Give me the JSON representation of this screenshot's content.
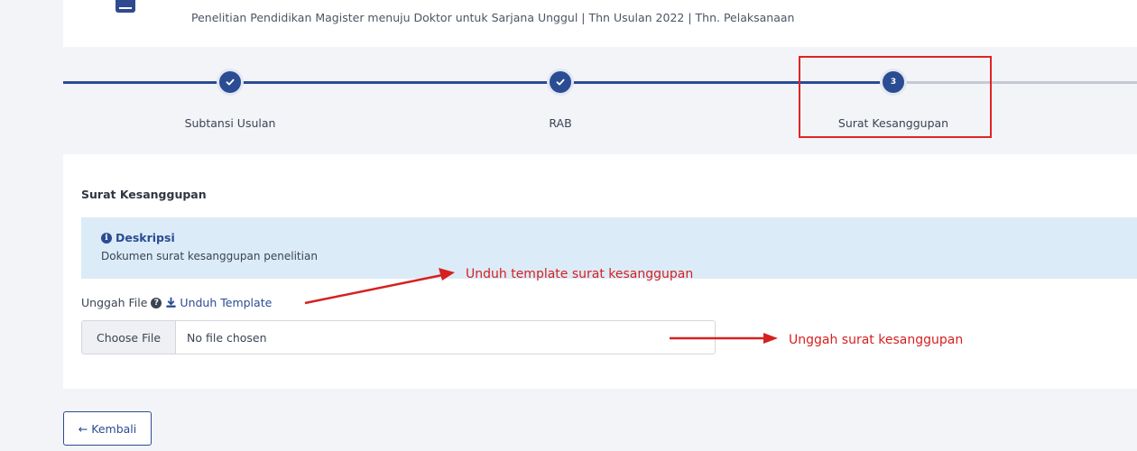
{
  "header": {
    "subtitle": "Penelitian Pendidikan Magister menuju Doktor untuk Sarjana Unggul | Thn Usulan 2022 | Thn. Pelaksanaan"
  },
  "stepper": {
    "steps": [
      {
        "label": "Subtansi Usulan",
        "state": "done",
        "icon": "check-icon"
      },
      {
        "label": "RAB",
        "state": "done",
        "icon": "check-icon"
      },
      {
        "label": "Surat Kesanggupan",
        "state": "active",
        "number": "3"
      }
    ]
  },
  "section": {
    "title": "Surat Kesanggupan",
    "alert": {
      "title": "Deskripsi",
      "text": "Dokumen surat kesanggupan penelitian"
    },
    "upload": {
      "label": "Unggah File",
      "download_label": "Unduh Template",
      "choose_button": "Choose File",
      "status": "No file chosen"
    }
  },
  "annotations": {
    "download_note": "Unduh template surat kesanggupan",
    "upload_note": "Unggah surat kesanggupan"
  },
  "footer": {
    "back_label": "Kembali"
  },
  "colors": {
    "primary": "#2a4c93",
    "alert_bg": "#dcebf8",
    "annotation": "#d62020",
    "page_bg": "#f3f4f8"
  }
}
